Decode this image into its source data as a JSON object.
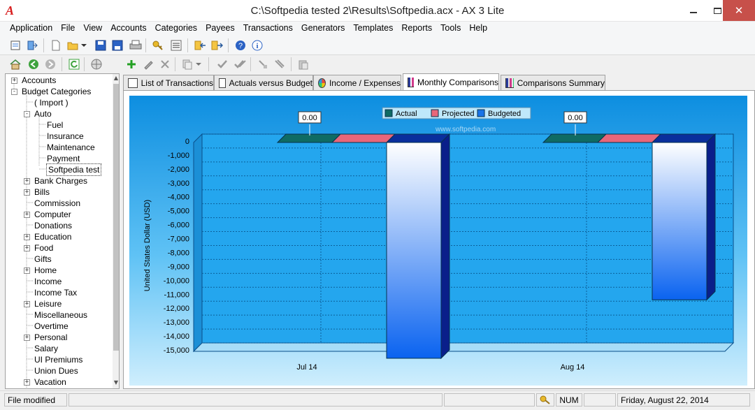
{
  "window": {
    "title": "C:\\Softpedia tested 2\\Results\\Softpedia.acx - AX 3 Lite",
    "logo_text": "A",
    "minimize_label": "",
    "maximize_label": "",
    "close_label": "✕"
  },
  "menu": {
    "items": [
      "Application",
      "File",
      "View",
      "Accounts",
      "Categories",
      "Payees",
      "Transactions",
      "Generators",
      "Templates",
      "Reports",
      "Tools",
      "Help"
    ]
  },
  "toolbar": {
    "icons": [
      "properties-icon",
      "exit-icon",
      "new-file-icon",
      "open-folder-icon",
      "dropdown-arrow-icon",
      "save-icon",
      "save-as-icon",
      "print-icon",
      "key-icon",
      "list-icon",
      "import-icon",
      "export-icon",
      "help-icon",
      "info-icon"
    ]
  },
  "nav_toolbar": {
    "icons": [
      "home-icon",
      "back-icon",
      "forward-icon",
      "refresh-icon",
      "globe-icon"
    ]
  },
  "edit_toolbar": {
    "icons": [
      "add-icon",
      "edit-icon",
      "delete-icon",
      "copy-icon",
      "dropdown-arrow-icon",
      "check-icon",
      "check-all-icon",
      "clear-icon",
      "clear-all-icon",
      "paste-icon"
    ]
  },
  "tree": {
    "items": [
      {
        "label": "Accounts",
        "level": 0,
        "expander": "+"
      },
      {
        "label": "Budget Categories",
        "level": 0,
        "expander": "-"
      },
      {
        "label": "( Import )",
        "level": 1,
        "expander": ""
      },
      {
        "label": "Auto",
        "level": 1,
        "expander": "-"
      },
      {
        "label": "Fuel",
        "level": 2,
        "expander": ""
      },
      {
        "label": "Insurance",
        "level": 2,
        "expander": ""
      },
      {
        "label": "Maintenance",
        "level": 2,
        "expander": ""
      },
      {
        "label": "Payment",
        "level": 2,
        "expander": ""
      },
      {
        "label": "Softpedia test",
        "level": 2,
        "expander": "",
        "selected": true
      },
      {
        "label": "Bank Charges",
        "level": 1,
        "expander": "+"
      },
      {
        "label": "Bills",
        "level": 1,
        "expander": "+"
      },
      {
        "label": "Commission",
        "level": 1,
        "expander": ""
      },
      {
        "label": "Computer",
        "level": 1,
        "expander": "+"
      },
      {
        "label": "Donations",
        "level": 1,
        "expander": ""
      },
      {
        "label": "Education",
        "level": 1,
        "expander": "+"
      },
      {
        "label": "Food",
        "level": 1,
        "expander": "+"
      },
      {
        "label": "Gifts",
        "level": 1,
        "expander": ""
      },
      {
        "label": "Home",
        "level": 1,
        "expander": "+"
      },
      {
        "label": "Income",
        "level": 1,
        "expander": ""
      },
      {
        "label": "Income Tax",
        "level": 1,
        "expander": ""
      },
      {
        "label": "Leisure",
        "level": 1,
        "expander": "+"
      },
      {
        "label": "Miscellaneous",
        "level": 1,
        "expander": ""
      },
      {
        "label": "Overtime",
        "level": 1,
        "expander": ""
      },
      {
        "label": "Personal",
        "level": 1,
        "expander": "+"
      },
      {
        "label": "Salary",
        "level": 1,
        "expander": ""
      },
      {
        "label": "UI Premiums",
        "level": 1,
        "expander": ""
      },
      {
        "label": "Union Dues",
        "level": 1,
        "expander": ""
      },
      {
        "label": "Vacation",
        "level": 1,
        "expander": "+"
      }
    ],
    "scroll_up": "▲",
    "scroll_down": "▼"
  },
  "tabs": [
    {
      "label": "List of Transactions",
      "icon": "list-icon"
    },
    {
      "label": "Actuals versus Budget",
      "icon": "table-icon"
    },
    {
      "label": "Income / Expenses",
      "icon": "pie-chart-icon"
    },
    {
      "label": "Monthly Comparisons",
      "icon": "bar-chart-icon",
      "active": true
    },
    {
      "label": "Comparisons Summary",
      "icon": "bar-chart-icon"
    }
  ],
  "chart_data": {
    "type": "bar",
    "categories": [
      "Jul 14",
      "Aug 14"
    ],
    "series": [
      {
        "name": "Actual",
        "color": "#0f6b63",
        "values": [
          0,
          0
        ]
      },
      {
        "name": "Projected",
        "color": "#e8667a",
        "values": [
          0,
          0
        ]
      },
      {
        "name": "Budgeted",
        "color": "#1a74e8",
        "values": [
          -15500,
          -11300
        ]
      }
    ],
    "data_labels": [
      "0.00",
      "0.00"
    ],
    "ylabel": "United States Dollar (USD)",
    "ylim": [
      -15000,
      0
    ],
    "yticks": [
      "0",
      "-1,000",
      "-2,000",
      "-3,000",
      "-4,000",
      "-5,000",
      "-6,000",
      "-7,000",
      "-8,000",
      "-9,000",
      "-10,000",
      "-11,000",
      "-12,000",
      "-13,000",
      "-14,000",
      "-15,000"
    ],
    "legend": "top",
    "grid": true,
    "watermark": "www.softpedia.com"
  },
  "status": {
    "message": "File modified",
    "num": "NUM",
    "date": "Friday, August 22, 2014"
  }
}
